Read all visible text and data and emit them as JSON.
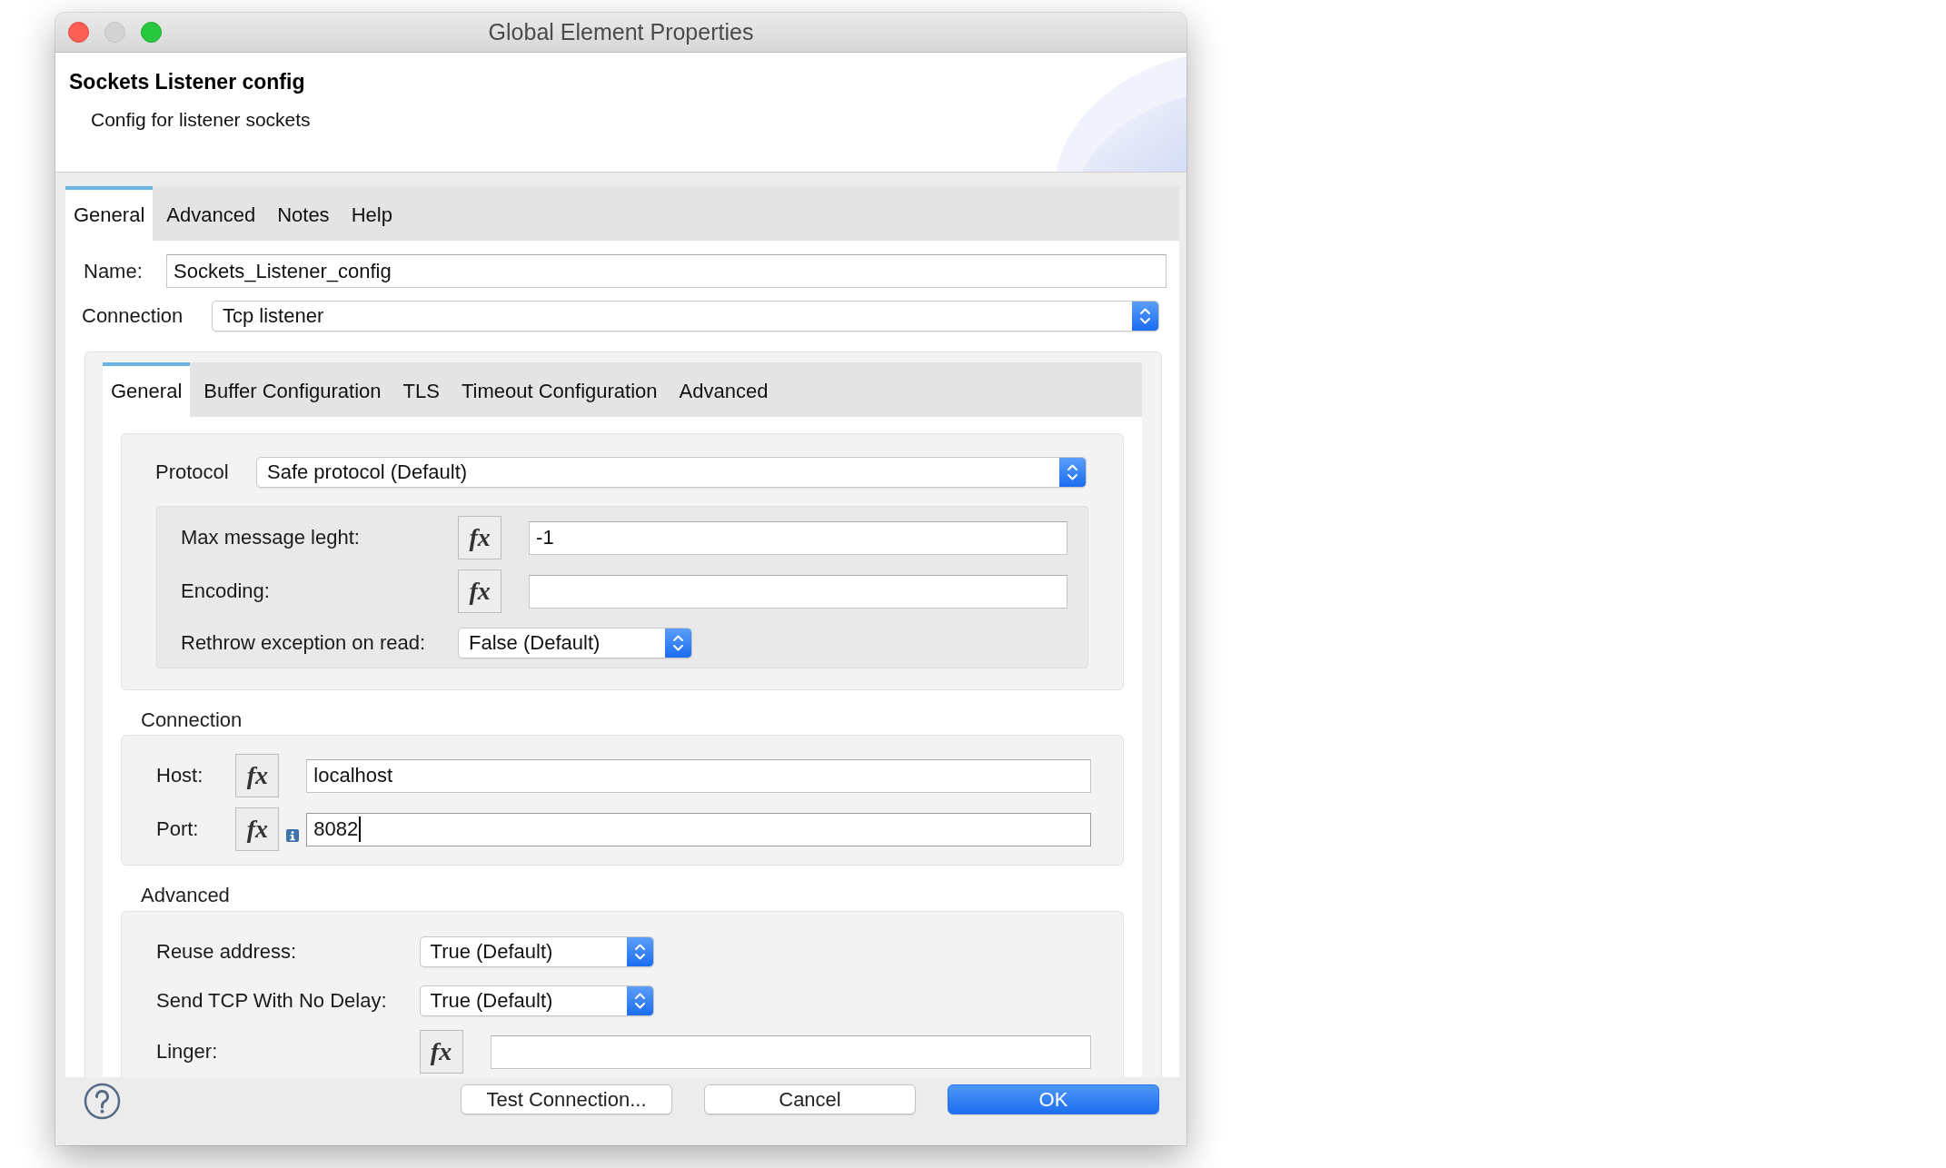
{
  "window": {
    "title": "Global Element Properties",
    "controls": [
      {
        "kind": "close",
        "disabled": false
      },
      {
        "kind": "minimize",
        "disabled": true
      },
      {
        "kind": "zoom",
        "disabled": false
      }
    ]
  },
  "header": {
    "title": "Sockets Listener config",
    "description": "Config for listener sockets"
  },
  "tabs": [
    {
      "label": "General",
      "selected": true
    },
    {
      "label": "Advanced",
      "selected": false
    },
    {
      "label": "Notes",
      "selected": false
    },
    {
      "label": "Help",
      "selected": false
    }
  ],
  "form": {
    "name": {
      "label": "Name:",
      "value": "Sockets_Listener_config"
    },
    "connection": {
      "label": "Connection",
      "value": "Tcp listener"
    }
  },
  "connection_tabs": [
    {
      "label": "General",
      "selected": true
    },
    {
      "label": "Buffer Configuration",
      "selected": false
    },
    {
      "label": "TLS",
      "selected": false
    },
    {
      "label": "Timeout Configuration",
      "selected": false
    },
    {
      "label": "Advanced",
      "selected": false
    }
  ],
  "protocol": {
    "label": "Protocol",
    "value": "Safe protocol (Default)",
    "fields": [
      {
        "kind": "expression",
        "label": "Max message leght:",
        "fx_button": "fx",
        "value": "-1",
        "info": false,
        "focused": false
      },
      {
        "kind": "expression",
        "label": "Encoding:",
        "fx_button": "fx",
        "info": false,
        "focused": false
      },
      {
        "kind": "select",
        "label": "Rethrow exception on read:",
        "value": "False (Default)",
        "info": false,
        "focused": false
      }
    ]
  },
  "sections": [
    {
      "title": "Connection",
      "fields": [
        {
          "kind": "expression",
          "label": "Host:",
          "fx_button": "fx",
          "value": "localhost",
          "info": false,
          "focused": false
        },
        {
          "kind": "expression",
          "label": "Port:",
          "fx_button": "fx",
          "value": "8082",
          "info": true,
          "focused": true
        }
      ]
    },
    {
      "title": "Advanced",
      "fields": [
        {
          "kind": "select",
          "label": "Reuse address:",
          "value": "True (Default)",
          "info": false,
          "focused": false
        },
        {
          "kind": "select",
          "label": "Send TCP With No Delay:",
          "value": "True (Default)",
          "info": false,
          "focused": false
        },
        {
          "kind": "expression",
          "label": "Linger:",
          "fx_button": "fx",
          "info": false,
          "focused": false
        }
      ]
    }
  ],
  "buttons": [
    {
      "label": "Test Connection...",
      "default": false
    },
    {
      "label": "Cancel",
      "default": false
    },
    {
      "label": "OK",
      "default": true
    }
  ]
}
